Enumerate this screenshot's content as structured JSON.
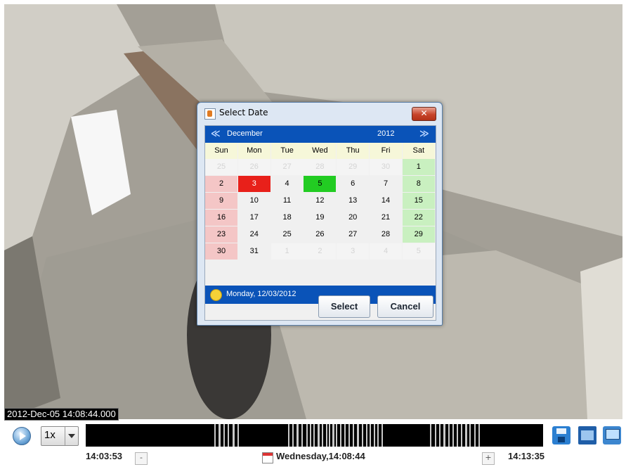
{
  "video": {
    "timestamp_overlay": "2012-Dec-05 14:08:44.000"
  },
  "dialog": {
    "title": "Select Date",
    "close_label": "✕",
    "month": "December",
    "year": "2012",
    "prev_label": "≪",
    "next_label": "≫",
    "weekdays": [
      "Sun",
      "Mon",
      "Tue",
      "Wed",
      "Thu",
      "Fri",
      "Sat"
    ],
    "weeks": [
      [
        "25",
        "26",
        "27",
        "28",
        "29",
        "30",
        "1"
      ],
      [
        "2",
        "3",
        "4",
        "5",
        "6",
        "7",
        "8"
      ],
      [
        "9",
        "10",
        "11",
        "12",
        "13",
        "14",
        "15"
      ],
      [
        "16",
        "17",
        "18",
        "19",
        "20",
        "21",
        "22"
      ],
      [
        "23",
        "24",
        "25",
        "26",
        "27",
        "28",
        "29"
      ],
      [
        "30",
        "31",
        "1",
        "2",
        "3",
        "4",
        "5"
      ]
    ],
    "today_text": "Monday, 12/03/2012",
    "select_label": "Select",
    "cancel_label": "Cancel",
    "colors": {
      "header": "#0a53b8",
      "weekend_sun": "#f4c6c6",
      "weekend_sat": "#c9f0c0",
      "today": "#e8201a",
      "selected": "#22cc22",
      "dow_bg": "#f6f7d9"
    }
  },
  "controls": {
    "speed": "1x",
    "start_time": "14:03:53",
    "current_time": "Wednesday,14:08:44",
    "end_time": "14:13:35",
    "minus_label": "-",
    "plus_label": "+"
  }
}
